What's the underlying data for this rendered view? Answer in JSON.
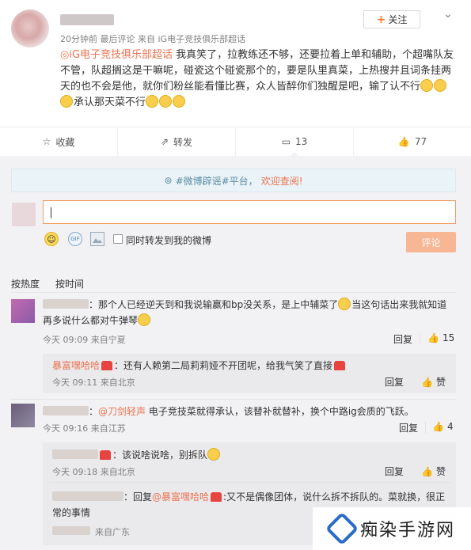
{
  "post": {
    "meta": "20分钟前 最后评论 来自 iG电子竞技俱乐部超话",
    "follow_label": "关注",
    "tag": "iG电子竞技俱乐部超话",
    "text": "我真笑了，拉教练还不够，还要拉着上单和辅助，个超嘴队友不管，队超搁这是干嘛呢，碰瓷这个碰瓷那个的，要是队里真菜，上热搜并且词条挂两天的也不会是他，就你们粉丝能看懂比赛，众人皆醉你们独醒是吧，输了认不行",
    "text_tail": "承认那天菜不行"
  },
  "actions": {
    "collect": "收藏",
    "forward": "转发",
    "comment_count": "13",
    "like_count": "77"
  },
  "notice": {
    "prefix": "#微博辟谣#平台，",
    "highlight": "欢迎查阅!"
  },
  "composer": {
    "forward_label": "同时转发到我的微博",
    "submit_label": "评论"
  },
  "sort": {
    "hot": "按热度",
    "time": "按时间"
  },
  "comments": [
    {
      "text_a": "：那个人已经逆天到和我说输赢和bp没关系，是上中辅菜了",
      "text_b": "当这句话出来我就知道再多说什么都对牛弹琴",
      "meta": "今天 09:09 来自宁夏",
      "reply": "回复",
      "likes": "15",
      "replies": [
        {
          "user": "暴富嘿哈哈",
          "text": "：还有人赖第二局莉莉娅不开团呢，给我气笑了直接",
          "meta": "今天 09:11 来自北京",
          "reply": "回复",
          "like": "赞"
        }
      ]
    },
    {
      "mention": "@刀剑轻声",
      "text": " 电子竞技菜就得承认，该替补就替补，换个中路ig会质的飞跃。",
      "meta": "今天 09:16 来自江苏",
      "reply": "回复",
      "likes": "4",
      "replies": [
        {
          "text": "：该说啥说啥，别拆队",
          "meta": "今天 09:18 来自北京",
          "reply": "回复",
          "like": "赞"
        },
        {
          "prefix": "：回复",
          "mention": "@暴富嘿哈哈",
          "text": ":又不是偶像团体，说什么拆不拆队的。菜就换，很正常的事情",
          "meta": "来自广东"
        }
      ]
    }
  ],
  "watermark": "痴染手游网"
}
